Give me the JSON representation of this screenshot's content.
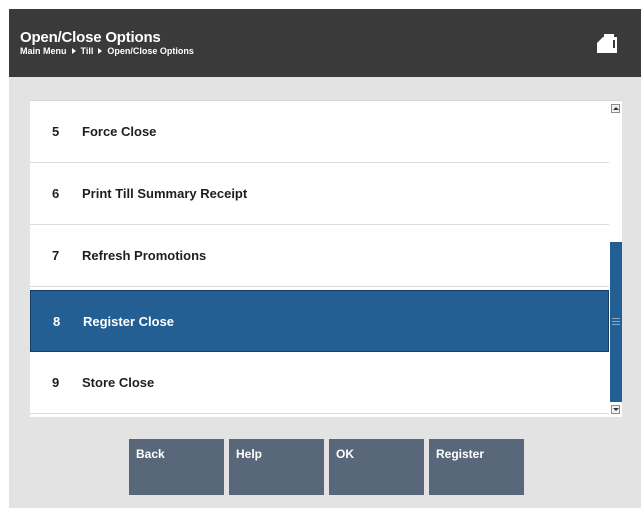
{
  "header": {
    "title": "Open/Close Options",
    "breadcrumb": [
      "Main Menu",
      "Till",
      "Open/Close Options"
    ],
    "icon": "register-icon"
  },
  "menu": {
    "items": [
      {
        "number": "5",
        "label": "Force Close",
        "selected": false
      },
      {
        "number": "6",
        "label": "Print Till Summary Receipt",
        "selected": false
      },
      {
        "number": "7",
        "label": "Refresh Promotions",
        "selected": false
      },
      {
        "number": "8",
        "label": "Register Close",
        "selected": true
      },
      {
        "number": "9",
        "label": "Store Close",
        "selected": false
      }
    ]
  },
  "buttons": {
    "back": "Back",
    "help": "Help",
    "ok": "OK",
    "register": "Register"
  },
  "colors": {
    "header_bg": "#3a3a3a",
    "selection": "#235f92",
    "button_bg": "#58687a"
  }
}
